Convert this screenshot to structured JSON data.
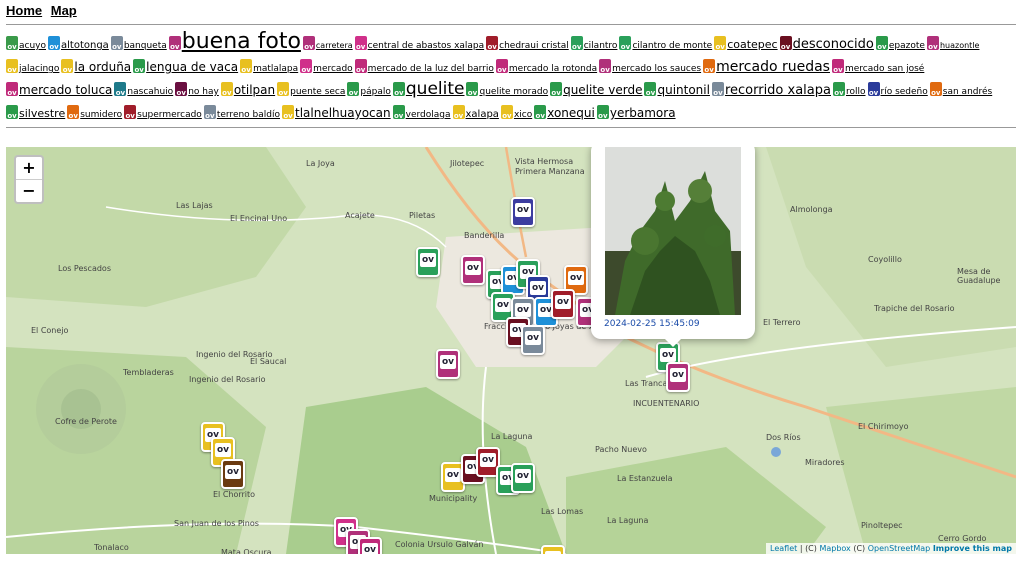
{
  "nav": {
    "home": "Home",
    "map": "Map"
  },
  "tags": [
    {
      "label": "acuyo",
      "size": "s9",
      "color": "#3a9a4a"
    },
    {
      "label": "altotonga",
      "size": "s10",
      "color": "#1e90d8"
    },
    {
      "label": "banqueta",
      "size": "s9",
      "color": "#7a8a9a"
    },
    {
      "label": "buena foto",
      "size": "s22",
      "color": "#b0307a"
    },
    {
      "label": "carretera",
      "size": "s8",
      "color": "#b0307a"
    },
    {
      "label": "central de abastos xalapa",
      "size": "s9",
      "color": "#d0308a"
    },
    {
      "label": "chedraui cristal",
      "size": "s9",
      "color": "#a01d2a"
    },
    {
      "label": "cilantro",
      "size": "s9",
      "color": "#2aa05a"
    },
    {
      "label": "cilantro de monte",
      "size": "s9",
      "color": "#2aa05a"
    },
    {
      "label": "coatepec",
      "size": "s11",
      "color": "#e8c020"
    },
    {
      "label": "desconocido",
      "size": "s13",
      "color": "#6a0f20"
    },
    {
      "label": "epazote",
      "size": "s9",
      "color": "#2a9a4a"
    },
    {
      "label": "huazontle",
      "size": "s8",
      "color": "#b0307a"
    },
    {
      "label": "jalacingo",
      "size": "s9",
      "color": "#e8c020"
    },
    {
      "label": "la orduña",
      "size": "s12",
      "color": "#e8c020"
    },
    {
      "label": "lengua de vaca",
      "size": "s12",
      "color": "#2a9a4a"
    },
    {
      "label": "matlalapa",
      "size": "s9",
      "color": "#e8c020"
    },
    {
      "label": "mercado",
      "size": "s9",
      "color": "#d0308a"
    },
    {
      "label": "mercado de la luz del barrio",
      "size": "s9",
      "color": "#c02a7a"
    },
    {
      "label": "mercado la rotonda",
      "size": "s9",
      "color": "#c02a7a"
    },
    {
      "label": "mercado los sauces",
      "size": "s9",
      "color": "#b0307a"
    },
    {
      "label": "mercado ruedas",
      "size": "s14",
      "color": "#e06a10"
    },
    {
      "label": "mercado san josé",
      "size": "s9",
      "color": "#c02a7a"
    },
    {
      "label": "mercado toluca",
      "size": "s12",
      "color": "#c02a7a"
    },
    {
      "label": "nascahuio",
      "size": "s9",
      "color": "#1e7a8a"
    },
    {
      "label": "no hay",
      "size": "s9",
      "color": "#6a0f40"
    },
    {
      "label": "otilpan",
      "size": "s12",
      "color": "#e8c020"
    },
    {
      "label": "puente seca",
      "size": "s9",
      "color": "#e8c020"
    },
    {
      "label": "pápalo",
      "size": "s9",
      "color": "#2a9a4a"
    },
    {
      "label": "quelite",
      "size": "s17",
      "color": "#2a9a4a"
    },
    {
      "label": "quelite morado",
      "size": "s9",
      "color": "#2a9a4a"
    },
    {
      "label": "quelite verde",
      "size": "s12",
      "color": "#2a9a4a"
    },
    {
      "label": "quintonil",
      "size": "s12",
      "color": "#2a9a4a"
    },
    {
      "label": "recorrido xalapa",
      "size": "s13",
      "color": "#7a8a9a"
    },
    {
      "label": "rollo",
      "size": "s9",
      "color": "#2a9a4a"
    },
    {
      "label": "río sedeño",
      "size": "s9",
      "color": "#2a3a9a"
    },
    {
      "label": "san andrés",
      "size": "s9",
      "color": "#e06a10"
    },
    {
      "label": "silvestre",
      "size": "s11",
      "color": "#2a9a4a"
    },
    {
      "label": "sumidero",
      "size": "s9",
      "color": "#e06a10"
    },
    {
      "label": "supermercado",
      "size": "s9",
      "color": "#a01d2a"
    },
    {
      "label": "terreno baldío",
      "size": "s9",
      "color": "#7a8a9a"
    },
    {
      "label": "tlalnelhuayocan",
      "size": "s12",
      "color": "#e8c020"
    },
    {
      "label": "verdolaga",
      "size": "s9",
      "color": "#2a9a4a"
    },
    {
      "label": "xalapa",
      "size": "s10",
      "color": "#e8c020"
    },
    {
      "label": "xico",
      "size": "s9",
      "color": "#e8c020"
    },
    {
      "label": "xonequi",
      "size": "s12",
      "color": "#2a9a4a"
    },
    {
      "label": "yerbamora",
      "size": "s12",
      "color": "#2a9a4a"
    }
  ],
  "map": {
    "zoom_in": "+",
    "zoom_out": "−",
    "places": [
      "La Joya",
      "Jilotepec",
      "Vista Hermosa",
      "Primera Manzana",
      "Banderilla",
      "Acajete",
      "Piletas",
      "Las Lajas",
      "El Encinal Uno",
      "Los Pescados",
      "El Conejo",
      "Ingenio del Rosario",
      "El Saucal",
      "Tembladeras",
      "Ingenio del Rosario",
      "Cofre de Perote",
      "Fraccionamiento Joyas de Xalapa",
      "Las Trancas",
      "INCUENTENARIO",
      "La Laguna",
      "Pacho Nuevo",
      "La Estanzuela",
      "Las Lomas",
      "La Laguna",
      "Municipality",
      "El Chorrito",
      "San Juan de los Pinos",
      "Tonalaco",
      "Mata Oscura",
      "Colonia Ursulo Galván",
      "Almolonga",
      "Coyolillo",
      "Mesa de Guadalupe",
      "Trapiche del Rosario",
      "El Terrero",
      "El Chirimoyo",
      "Dos Ríos",
      "Miradores",
      "Pinoltepec",
      "Cerro Gordo"
    ],
    "popup": {
      "timestamp": "2024-02-25 15:45:09"
    },
    "attribution": {
      "leaflet": "Leaflet",
      "sep1": " | (C) ",
      "mapbox": "Mapbox",
      "sep2": " (C) ",
      "osm": "OpenStreetMap",
      "improve": "Improve this map"
    }
  }
}
